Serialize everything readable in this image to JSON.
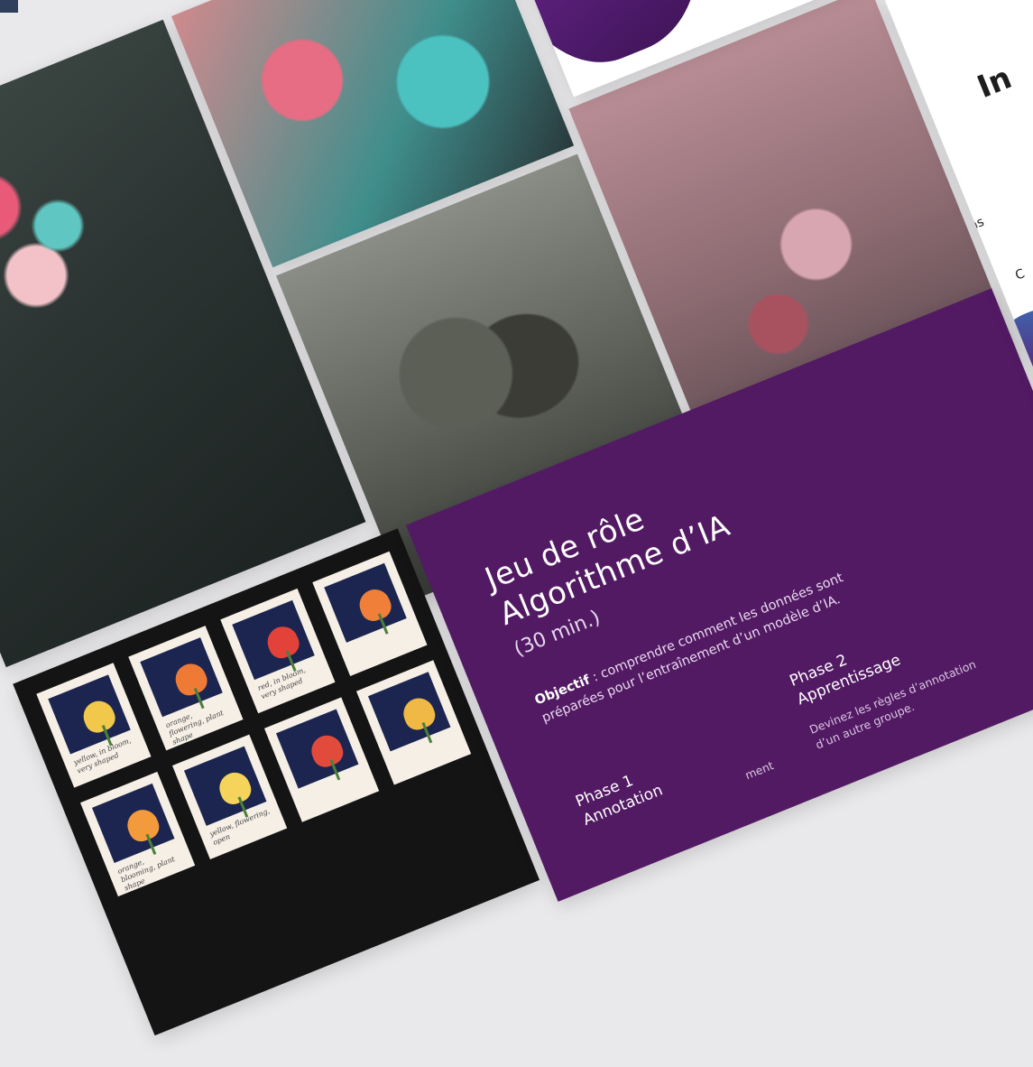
{
  "card": {
    "title_line1": "Jeu de rôle",
    "title_line2": "Algorithme d’IA",
    "duration": "(30 min.)",
    "objective_label": "Objectif",
    "objective_text": " : comprendre comment les données sont préparées pour l’entraînement d’un modèle d’IA.",
    "phase1_title": "Phase 1",
    "phase1_subtitle": "Annotation",
    "phase1_desc_fragment": "ment",
    "phase2_title": "Phase 2",
    "phase2_subtitle": "Apprentissage",
    "phase2_desc": "Devinez les règles d’annotation d’un autre groupe."
  },
  "right_card": {
    "title_fragment": "In",
    "label_a": "Clas",
    "label_b": "C"
  },
  "tulip_notes": [
    "yellow, in bloom, very shaped",
    "orange, flowering, plant shape",
    "red, in bloom, very shaped",
    "orange, blooming, plant shape",
    "yellow, flowering, open"
  ],
  "colors": {
    "card_purple": "#521a63",
    "background": "#e9e8ea",
    "corner_mark": "#2f3e5c"
  }
}
